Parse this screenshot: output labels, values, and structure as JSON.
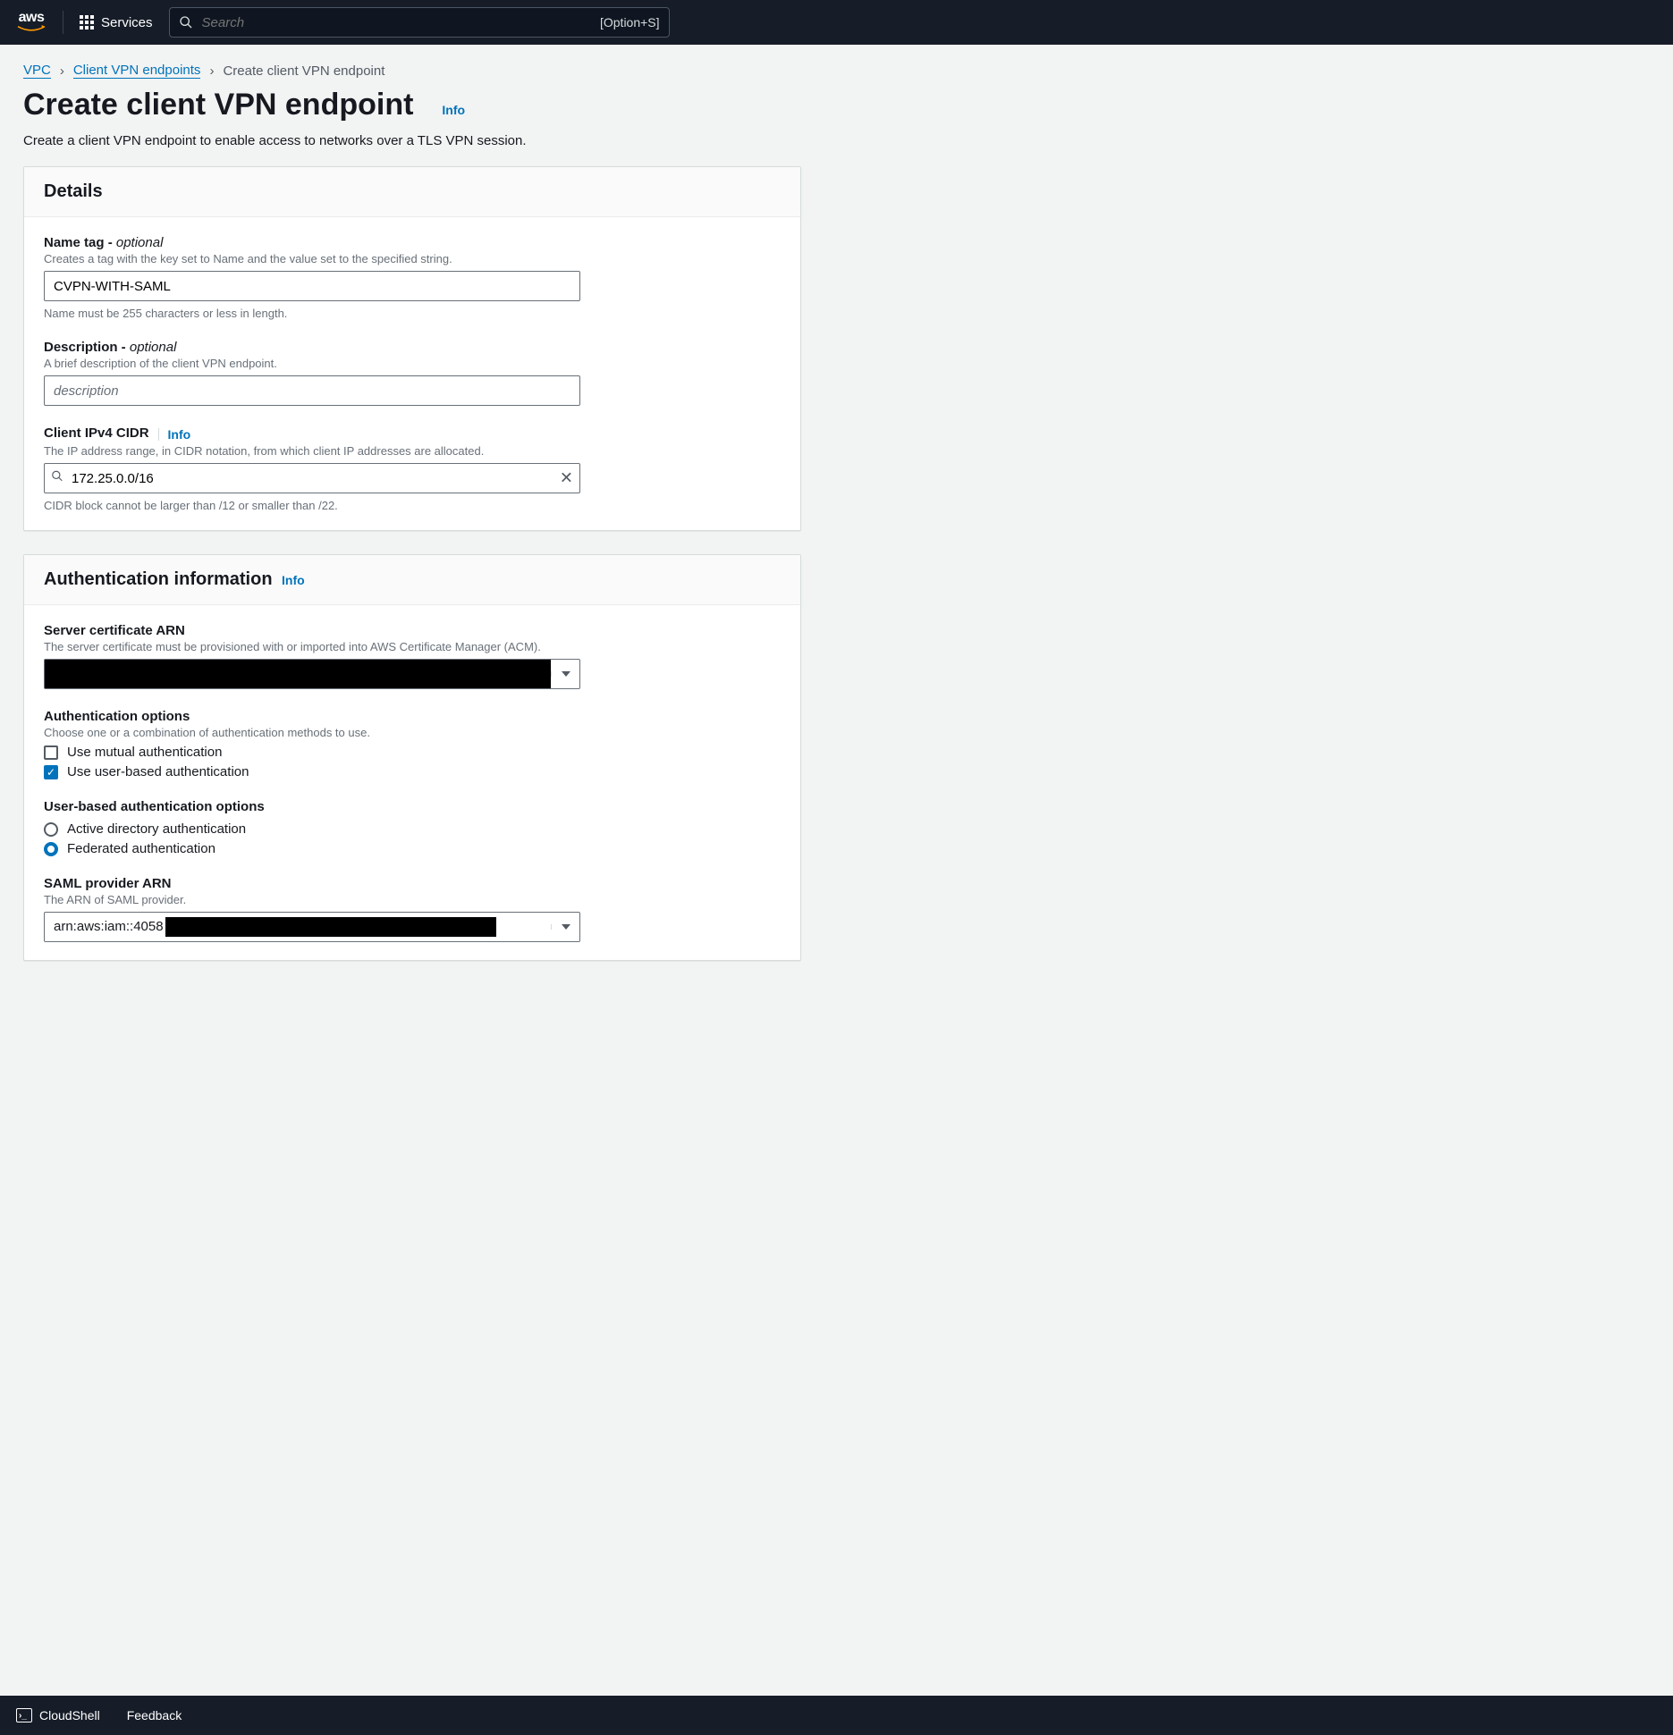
{
  "topbar": {
    "services_label": "Services",
    "search_placeholder": "Search",
    "shortcut": "[Option+S]"
  },
  "breadcrumb": {
    "vpc": "VPC",
    "endpoints": "Client VPN endpoints",
    "current": "Create client VPN endpoint"
  },
  "header": {
    "title": "Create client VPN endpoint",
    "info": "Info",
    "subtitle": "Create a client VPN endpoint to enable access to networks over a TLS VPN session."
  },
  "details": {
    "section_title": "Details",
    "name": {
      "label": "Name tag - ",
      "optional": "optional",
      "help": "Creates a tag with the key set to Name and the value set to the specified string.",
      "value": "CVPN-WITH-SAML",
      "help_below": "Name must be 255 characters or less in length."
    },
    "description": {
      "label": "Description - ",
      "optional": "optional",
      "help": "A brief description of the client VPN endpoint.",
      "placeholder": "description"
    },
    "cidr": {
      "label": "Client IPv4 CIDR",
      "info": "Info",
      "help": "The IP address range, in CIDR notation, from which client IP addresses are allocated.",
      "value": "172.25.0.0/16",
      "help_below": "CIDR block cannot be larger than /12 or smaller than /22."
    }
  },
  "auth": {
    "section_title": "Authentication information",
    "info": "Info",
    "server_cert": {
      "label": "Server certificate ARN",
      "help": "The server certificate must be provisioned with or imported into AWS Certificate Manager (ACM)."
    },
    "options": {
      "label": "Authentication options",
      "help": "Choose one or a combination of authentication methods to use.",
      "mutual": "Use mutual authentication",
      "user_based": "Use user-based authentication"
    },
    "user_based": {
      "label": "User-based authentication options",
      "ad": "Active directory authentication",
      "federated": "Federated authentication"
    },
    "saml": {
      "label": "SAML provider ARN",
      "help": "The ARN of SAML provider.",
      "value_prefix": "arn:aws:iam::4058"
    }
  },
  "footer": {
    "cloudshell": "CloudShell",
    "feedback": "Feedback"
  }
}
